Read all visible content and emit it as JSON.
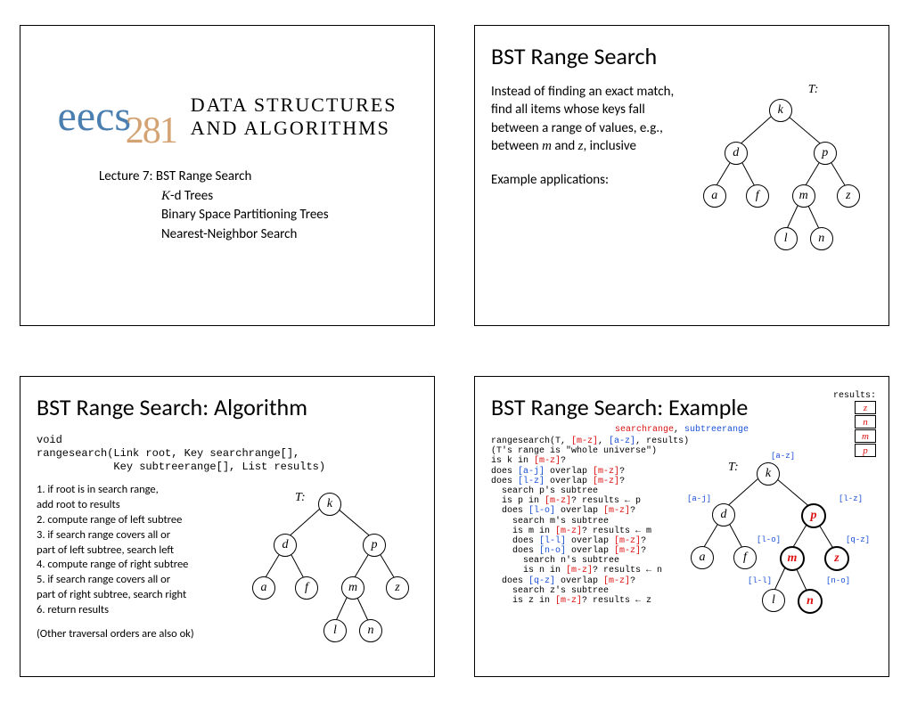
{
  "slide1": {
    "eecs": "eecs",
    "num": "281",
    "course_line1": "DATA STRUCTURES",
    "course_line2": "AND ALGORITHMS",
    "lec_line1": "Lecture 7: BST Range Search",
    "lec_line2": "K-d Trees",
    "lec_line3": "Binary Space Partitioning Trees",
    "lec_line4": "Nearest-Neighbor Search"
  },
  "slide2": {
    "title": "BST Range Search",
    "para1a": "Instead of finding an exact match, find all items whose keys fall between a range of values, e.g., between ",
    "m": "m",
    "and": " and ",
    "z": "z",
    "para1b": ", inclusive",
    "para2": "Example applications:",
    "Tlabel": "T:",
    "nodes": {
      "k": "k",
      "d": "d",
      "p": "p",
      "a": "a",
      "f": "f",
      "m": "m",
      "z": "z",
      "l": "l",
      "n": "n"
    }
  },
  "slide3": {
    "title": "BST Range Search: Algorithm",
    "code1": "void",
    "code2": "rangesearch(Link root, Key searchrange[],",
    "code3": "            Key subtreerange[], List results)",
    "l1a": "1.  if root is in search range,",
    "l1b": "        add root to results",
    "l2": "2.  compute range of left subtree",
    "l3a": "3.  if search range covers all or",
    "l3b": "        part of left subtree, search left",
    "l4": "4.  compute range of right subtree",
    "l5a": "5.  if search range covers all or",
    "l5b": "        part of right subtree, search right",
    "l6": "6.  return results",
    "note": "(Other traversal orders are also ok)",
    "Tlabel": "T:"
  },
  "slide4": {
    "title": "BST Range Search: Example",
    "header_sr": "searchrange",
    "header_st": "subtreerange",
    "results_label": "results:",
    "results": [
      "z",
      "n",
      "m",
      "p"
    ],
    "Tlabel": "T:",
    "ranges": {
      "az": "[a-z]",
      "aj": "[a-j]",
      "lz": "[l-z]",
      "lo": "[l-o]",
      "qz": "[q-z]",
      "ll": "[l-l]",
      "no": "[n-o]"
    },
    "lines": [
      {
        "pre": "rangesearch(T, ",
        "r": "[m-z]",
        "mid": ", ",
        "b": "[a-z]",
        "post": ", results)"
      },
      {
        "plain": "(T's range is \"whole universe\")"
      },
      {
        "pre": "is k in ",
        "r": "[m-z]",
        "post": "?"
      },
      {
        "pre": "does ",
        "b": "[a-j]",
        "mid": " overlap ",
        "r": "[m-z]",
        "post": "?"
      },
      {
        "pre": "does ",
        "b": "[l-z]",
        "mid": " overlap ",
        "r": "[m-z]",
        "post": "?"
      },
      {
        "plain": "  search p's subtree"
      },
      {
        "pre": "  is p in ",
        "r": "[m-z]",
        "post": "? results ← p"
      },
      {
        "pre": "  does ",
        "b": "[l-o]",
        "mid": " overlap ",
        "r": "[m-z]",
        "post": "?"
      },
      {
        "plain": "    search m's subtree"
      },
      {
        "pre": "    is m in ",
        "r": "[m-z]",
        "post": "? results ← m"
      },
      {
        "pre": "    does ",
        "b": "[l-l]",
        "mid": " overlap ",
        "r": "[m-z]",
        "post": "?"
      },
      {
        "pre": "    does ",
        "b": "[n-o]",
        "mid": " overlap ",
        "r": "[m-z]",
        "post": "?"
      },
      {
        "plain": "      search n's subtree"
      },
      {
        "pre": "      is n in ",
        "r": "[m-z]",
        "post": "? results ← n"
      },
      {
        "pre": "  does ",
        "b": "[q-z]",
        "mid": " overlap ",
        "r": "[m-z]",
        "post": "?"
      },
      {
        "plain": "    search z's subtree"
      },
      {
        "pre": "    is z in ",
        "r": "[m-z]",
        "post": "? results ← z"
      }
    ]
  }
}
